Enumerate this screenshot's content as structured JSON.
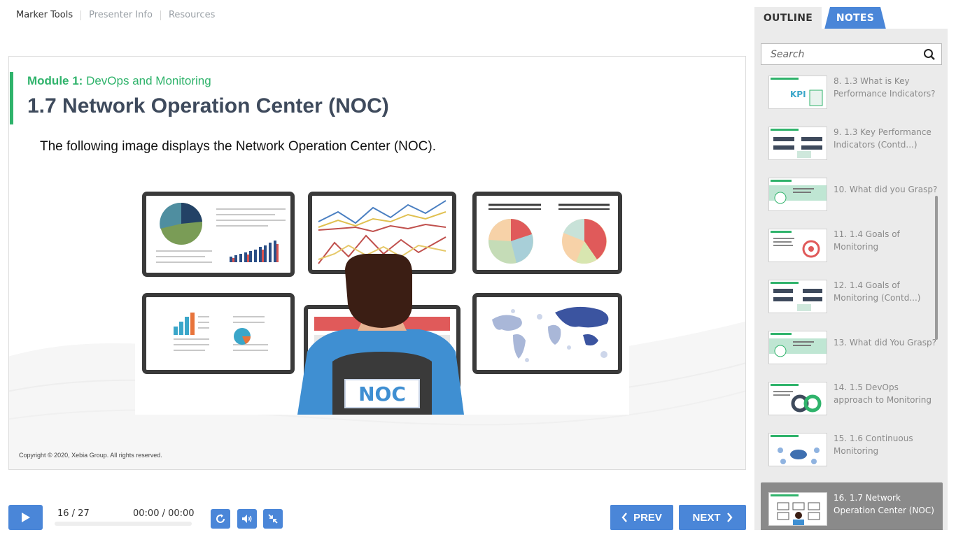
{
  "top_menu": {
    "items": [
      "Marker Tools",
      "Presenter Info",
      "Resources"
    ]
  },
  "slide": {
    "module_prefix": "Module 1:",
    "module_name": "DevOps and Monitoring",
    "title": "1.7 Network Operation Center (NOC)",
    "body": "The following image displays the Network Operation Center (NOC).",
    "noc_badge": "NOC",
    "copyright": "Copyright © 2020, Xebia Group. All rights reserved."
  },
  "player": {
    "slide_counter": "16 / 27",
    "time": "00:00 / 00:00",
    "progress_percent": 0,
    "prev_label": "PREV",
    "next_label": "NEXT"
  },
  "sidebar": {
    "tabs": {
      "outline": "OUTLINE",
      "notes": "NOTES"
    },
    "search_placeholder": "Search",
    "items": [
      {
        "label": "8. 1.3 What is Key Performance Indicators?",
        "thumb": "kpi"
      },
      {
        "label": "9. 1.3 Key Performance Indicators (Contd...)",
        "thumb": "kpi-contd"
      },
      {
        "label": "10. What did you Grasp?",
        "thumb": "quiz"
      },
      {
        "label": "11. 1.4 Goals of Monitoring",
        "thumb": "target"
      },
      {
        "label": "12. 1.4 Goals of Monitoring (Contd...)",
        "thumb": "goals-contd"
      },
      {
        "label": "13. What did You Grasp?",
        "thumb": "quiz"
      },
      {
        "label": "14. 1.5 DevOps approach to Monitoring",
        "thumb": "devops"
      },
      {
        "label": "15. 1.6 Continuous Monitoring",
        "thumb": "continuous"
      },
      {
        "label": "16. 1.7 Network Operation Center (NOC)",
        "thumb": "noc",
        "active": true
      }
    ]
  },
  "colors": {
    "accent_blue": "#4a86d8",
    "accent_green": "#2fb36b",
    "title_slate": "#3e4a5c"
  }
}
